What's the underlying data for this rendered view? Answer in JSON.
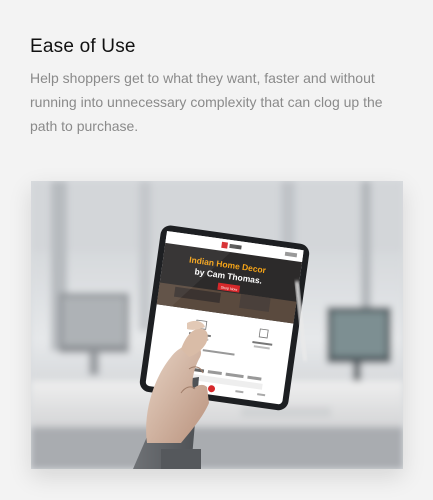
{
  "feature": {
    "title": "Ease of Use",
    "description": "Help shoppers get to what they want, faster and without running into unnecessary complexity that can clog up the path to purchase."
  },
  "tablet_screen": {
    "hero_line1": "Indian Home Decor",
    "hero_line2": "by Cam Thomas.",
    "hero_button": "Shop Now"
  },
  "colors": {
    "brand_red": "#d6282b",
    "hero_orange": "#f5a418",
    "card_bg": "#f3f3f3",
    "title_text": "#111111",
    "desc_text": "#8a8a8a"
  }
}
